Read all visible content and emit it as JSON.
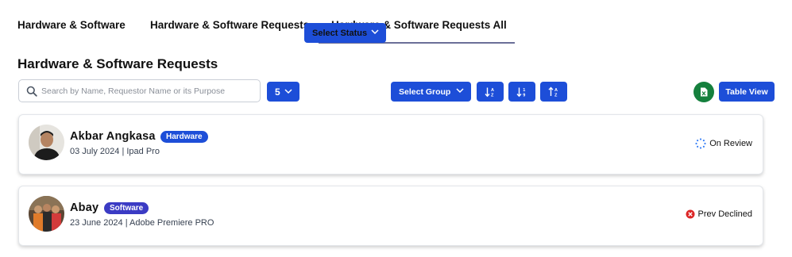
{
  "tabs": [
    {
      "label": "Hardware & Software"
    },
    {
      "label": "Hardware & Software Requests"
    },
    {
      "label": "Hardware & Software Requests All"
    }
  ],
  "page": {
    "title": "Hardware & Software Requests"
  },
  "search": {
    "placeholder": "Search by Name, Requestor Name or its Purpose",
    "value": ""
  },
  "toolbar": {
    "page_size": "5",
    "status_label": "Select Status",
    "group_label": "Select Group",
    "table_view_label": "Table View"
  },
  "requests": [
    {
      "name": "Akbar Angkasa",
      "category": "Hardware",
      "date": "03 July 2024",
      "item": "Ipad Pro",
      "status": "On Review",
      "status_icon": "spinner-icon"
    },
    {
      "name": "Abay",
      "category": "Software",
      "date": "23 June 2024",
      "item": "Adobe Premiere PRO",
      "status": "Prev Declined",
      "status_icon": "x-circle-icon"
    }
  ],
  "separator": " | ",
  "colors": {
    "primary": "#1d4ed8",
    "export_green": "#15803d",
    "software_badge": "#3b3bc4",
    "declined_red": "#dc2626",
    "review_blue": "#3b82f6"
  }
}
